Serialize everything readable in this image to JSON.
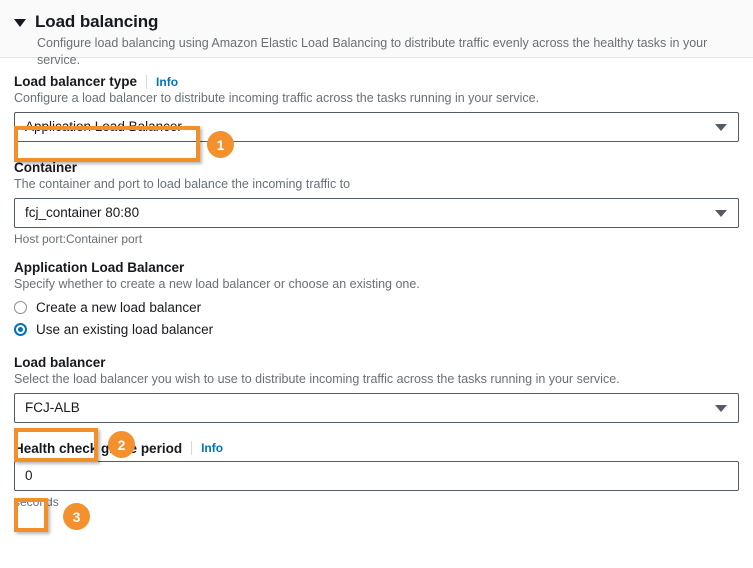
{
  "panel": {
    "title": "Load balancing",
    "description": "Configure load balancing using Amazon Elastic Load Balancing to distribute traffic evenly across the healthy tasks in your service.",
    "caret_icon": "caret-down-icon",
    "expanded": true
  },
  "colors": {
    "accent_blue": "#0073bb",
    "annotation_orange": "#f5902e",
    "border_gray": "#545b64",
    "text_primary": "#16191f",
    "text_secondary": "#687078",
    "header_bg": "#fafafa"
  },
  "fields": {
    "load_balancer_type": {
      "label": "Load balancer type",
      "info_label": "Info",
      "description": "Configure a load balancer to distribute incoming traffic across the tasks running in your service.",
      "value": "Application Load Balancer",
      "chevron_icon": "chevron-down-icon"
    },
    "container": {
      "label": "Container",
      "description": "The container and port to load balance the incoming traffic to",
      "value": "fcj_container 80:80",
      "hint": "Host port:Container port",
      "chevron_icon": "chevron-down-icon"
    },
    "application_load_balancer": {
      "label": "Application Load Balancer",
      "description": "Specify whether to create a new load balancer or choose an existing one.",
      "options": [
        {
          "label": "Create a new load balancer",
          "selected": false
        },
        {
          "label": "Use an existing load balancer",
          "selected": true
        }
      ]
    },
    "load_balancer": {
      "label": "Load balancer",
      "description": "Select the load balancer you wish to use to distribute incoming traffic across the tasks running in your service.",
      "value": "FCJ-ALB",
      "chevron_icon": "chevron-down-icon"
    },
    "health_check_grace_period": {
      "label": "Health check grace period",
      "info_label": "Info",
      "value": "0",
      "hint": "seconds"
    }
  },
  "annotations": [
    {
      "number": "1",
      "target": "load-balancer-type-select"
    },
    {
      "number": "2",
      "target": "load-balancer-select"
    },
    {
      "number": "3",
      "target": "health-check-grace-period-input"
    }
  ]
}
